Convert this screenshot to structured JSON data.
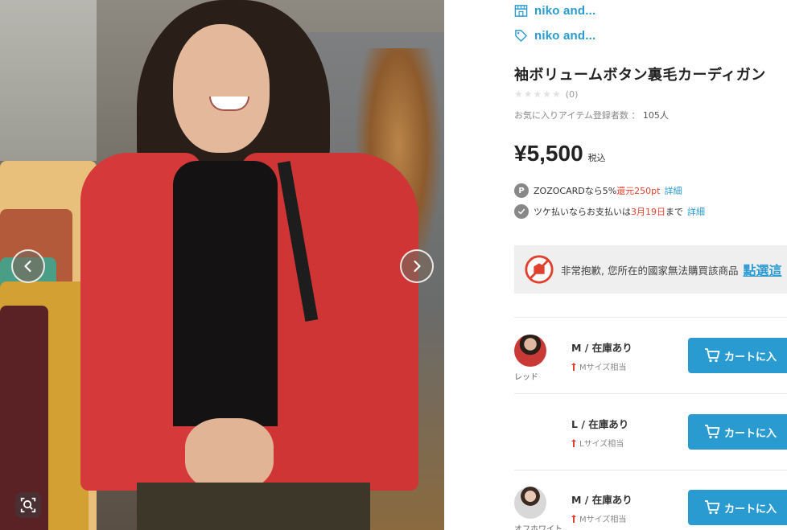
{
  "gallery": {
    "prev_label": "previous image",
    "next_label": "next image",
    "zoom_label": "zoom"
  },
  "brand": {
    "shop_name": "niko and...",
    "brand_name": "niko and..."
  },
  "product": {
    "title": "袖ボリュームボタン裏毛カーディガン",
    "rating_stars": "★★★★★",
    "review_count": "(0)",
    "favorites_label": "お気に入りアイテム登録者数",
    "favorites_sep": "：",
    "favorites_count": "105人",
    "price": "¥5,500",
    "tax_label": "税込"
  },
  "promos": [
    {
      "badge": "P",
      "prefix": "ZOZOCARDなら5%",
      "highlight_label": "還元",
      "highlight": "250pt",
      "link": "詳細"
    },
    {
      "badge": "",
      "prefix": "ツケ払いならお支払いは",
      "highlight": "3月19日",
      "suffix": "まで",
      "link": "詳細"
    }
  ],
  "notice": {
    "text": "非常抱歉, 您所在的國家無法購買該商品",
    "link": "點選這"
  },
  "variants": [
    {
      "color": "レッド",
      "size_stock": "M / 在庫あり",
      "fit": "Mサイズ相当",
      "button": "カートに入",
      "thumb_color": "#c93a36"
    },
    {
      "color": "",
      "size_stock": "L / 在庫あり",
      "fit": "Lサイズ相当",
      "button": "カートに入",
      "thumb_color": ""
    },
    {
      "color": "オフホワイト",
      "size_stock": "M / 在庫あり",
      "fit": "Mサイズ相当",
      "button": "カートに入",
      "thumb_color": "#d8d8d8"
    }
  ],
  "colors": {
    "accent": "#2a9bd1",
    "highlight": "#e0412f",
    "notice_bg": "#efefef"
  }
}
